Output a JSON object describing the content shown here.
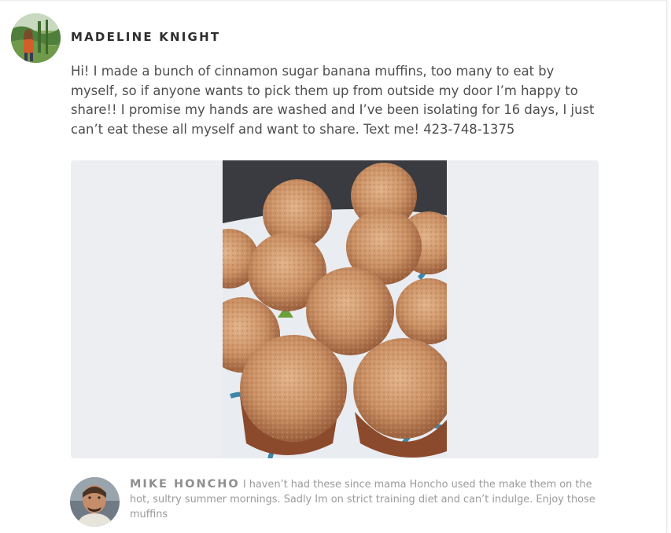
{
  "post": {
    "author_name": "MADELINE KNIGHT",
    "author_avatar_icon": "user-photo-avatar",
    "body": "Hi! I made a bunch of cinnamon sugar banana muffins, too many to eat by myself, so if anyone wants to pick them up from outside my door I’m happy to share!! I promise my hands are washed and I’ve been isolating for 16 days, I just can’t eat these all myself and want to share. Text me! 423-748-1375",
    "photo_icon": "muffins-photo"
  },
  "comments": [
    {
      "author_name": "MIKE HONCHO",
      "author_avatar_icon": "user-photo-avatar",
      "text": "I haven’t had these since mama Honcho used the make them on the hot, sultry summer mornings. Sadly Im on strict training diet and can’t indulge. Enjoy those muffins"
    }
  ],
  "colors": {
    "author_name": "#2e2e2e",
    "body_text": "#4e4e4e",
    "comment_text": "#9a9a9a",
    "media_background": "#eceef2"
  }
}
